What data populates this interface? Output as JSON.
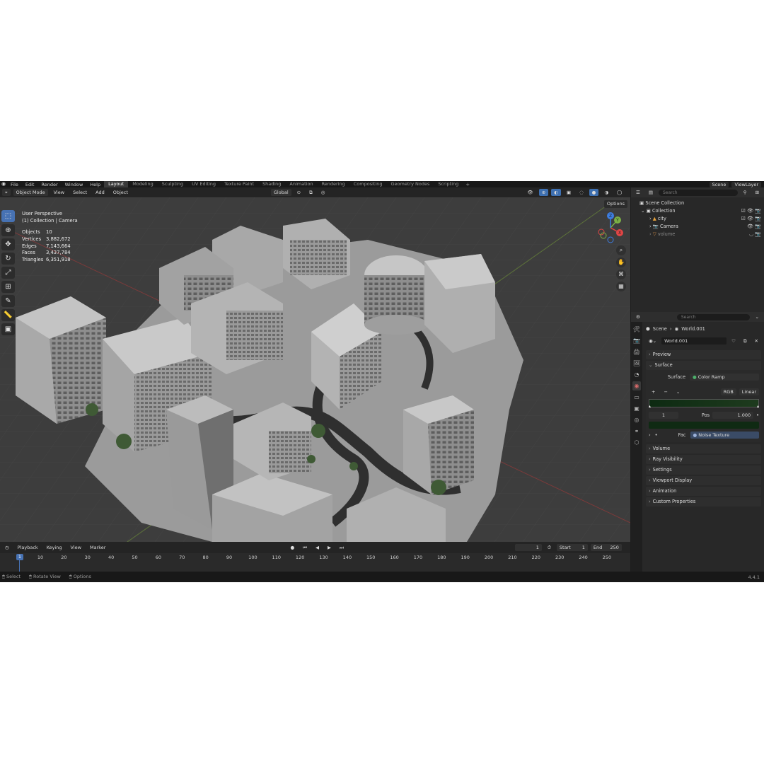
{
  "top_menu": {
    "items": [
      "File",
      "Edit",
      "Render",
      "Window",
      "Help"
    ],
    "workspaces": [
      "Layout",
      "Modeling",
      "Sculpting",
      "UV Editing",
      "Texture Paint",
      "Shading",
      "Animation",
      "Rendering",
      "Compositing",
      "Geometry Nodes",
      "Scripting"
    ],
    "active_workspace": "Layout",
    "scene_field": "Scene",
    "view_layer_field": "ViewLayer"
  },
  "viewport_header": {
    "mode": "Object Mode",
    "menus": [
      "View",
      "Select",
      "Add",
      "Object"
    ],
    "transform_orientation": "Global",
    "options_label": "Options"
  },
  "viewport": {
    "perspective": "User Perspective",
    "collection_line": "(1) Collection | Camera",
    "stats": [
      {
        "label": "Objects",
        "value": "10"
      },
      {
        "label": "Vertices",
        "value": "3,882,672"
      },
      {
        "label": "Edges",
        "value": "7,143,664"
      },
      {
        "label": "Faces",
        "value": "3,437,784"
      },
      {
        "label": "Triangles",
        "value": "6,351,918"
      }
    ],
    "gizmo_axes": [
      "X",
      "Y",
      "Z"
    ]
  },
  "timeline": {
    "menus": [
      "Playback",
      "Keying",
      "View",
      "Marker"
    ],
    "current_frame": "1",
    "start_label": "Start",
    "start": "1",
    "end_label": "End",
    "end": "250",
    "ticks": [
      "1",
      "10",
      "20",
      "30",
      "40",
      "50",
      "60",
      "70",
      "80",
      "90",
      "100",
      "110",
      "120",
      "130",
      "140",
      "150",
      "160",
      "170",
      "180",
      "190",
      "200",
      "210",
      "220",
      "230",
      "240",
      "250"
    ]
  },
  "statusbar": {
    "items": [
      "Select",
      "Rotate View",
      "Options"
    ],
    "version": "4.4.1"
  },
  "outliner": {
    "search_placeholder": "Search",
    "scene_collection": "Scene Collection",
    "collection": "Collection",
    "items": [
      "city",
      "Camera",
      "volume"
    ]
  },
  "properties": {
    "search_placeholder": "Search",
    "breadcrumb_scene": "Scene",
    "breadcrumb_world": "World.001",
    "world_name": "World.001",
    "panels_top": [
      "Preview",
      "Surface"
    ],
    "surface_label": "Surface",
    "surface_value": "Color Ramp",
    "color_mode": "RGB",
    "interpolation": "Linear",
    "stop_index": "1",
    "pos_label": "Pos",
    "pos_value": "1.000",
    "fac_label": "Fac",
    "fac_value": "Noise Texture",
    "panels_bottom": [
      "Volume",
      "Ray Visibility",
      "Settings",
      "Viewport Display",
      "Animation",
      "Custom Properties"
    ]
  },
  "colors": {
    "accent": "#4772b3",
    "ramp_dark": "#0d2a12",
    "ramp_light": "#1e3b1e"
  }
}
